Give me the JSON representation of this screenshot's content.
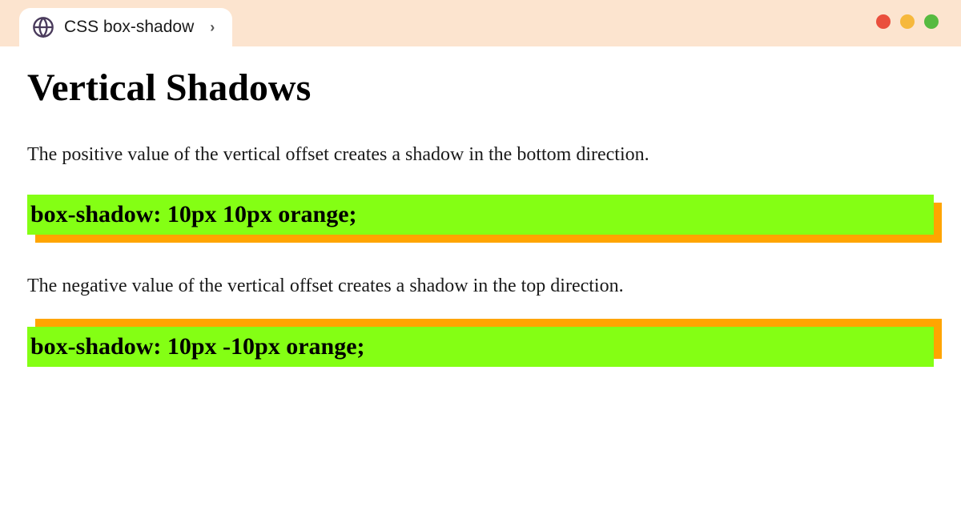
{
  "tab": {
    "title": "CSS box-shadow"
  },
  "content": {
    "heading": "Vertical Shadows",
    "paragraph1": "The positive value of the vertical offset creates a shadow in the bottom direction.",
    "code1": "box-shadow: 10px 10px orange;",
    "paragraph2": "The negative value of the vertical offset creates a shadow in the top direction.",
    "code2": "box-shadow: 10px -10px orange;"
  },
  "shadows": {
    "box1": "10px 10px orange",
    "box2": "10px -10px orange"
  },
  "colors": {
    "header_bg": "#fce4cf",
    "highlight_bg": "#84ff14",
    "shadow_color": "orange"
  }
}
